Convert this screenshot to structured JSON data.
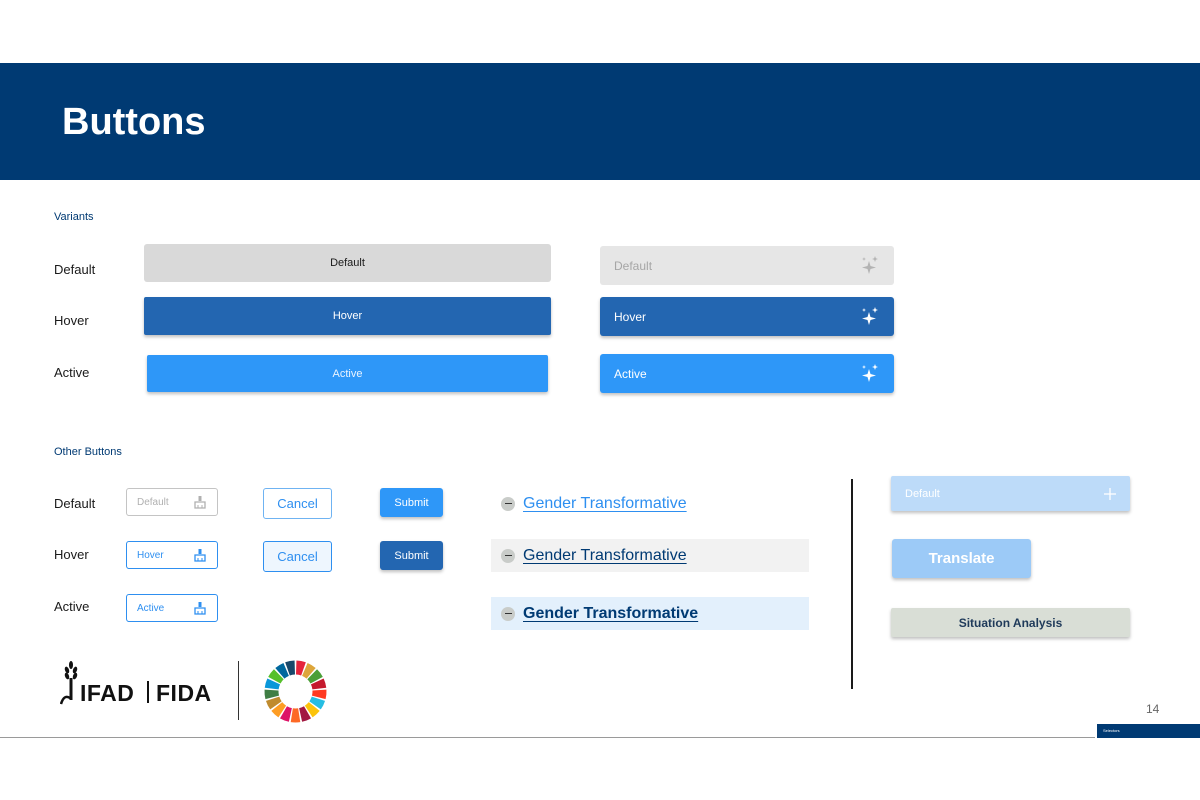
{
  "title": "Buttons",
  "variants": {
    "section_label": "Variants",
    "row_labels": {
      "default": "Default",
      "hover": "Hover",
      "active": "Active"
    },
    "wide_buttons": {
      "default": "Default",
      "hover": "Hover",
      "active": "Active"
    },
    "icon_buttons": {
      "default": "Default",
      "hover": "Hover",
      "active": "Active"
    }
  },
  "other": {
    "section_label": "Other Buttons",
    "row_labels": {
      "default": "Default",
      "hover": "Hover",
      "active": "Active"
    },
    "small_buttons": {
      "default": "Default",
      "hover": "Hover",
      "active": "Active"
    },
    "cancel": {
      "default": "Cancel",
      "hover": "Cancel"
    },
    "submit": {
      "default": "Submit",
      "hover": "Submit"
    },
    "links": {
      "default": "Gender Transformative",
      "hover": "Gender Transformative",
      "active": "Gender Transformative"
    },
    "right_column": {
      "default_add": "Default",
      "translate": "Translate",
      "situation": "Situation Analysis"
    }
  },
  "logos": {
    "ifad": "IFAD",
    "fida": "FIDA"
  },
  "page_number": "14",
  "thumbnail_label": "Selectors",
  "colors": {
    "navy": "#003a73",
    "hover_blue": "#2366b1",
    "active_blue": "#2e97f8",
    "light_blue": "#9ccaf7",
    "gray": "#d9d9d9"
  }
}
